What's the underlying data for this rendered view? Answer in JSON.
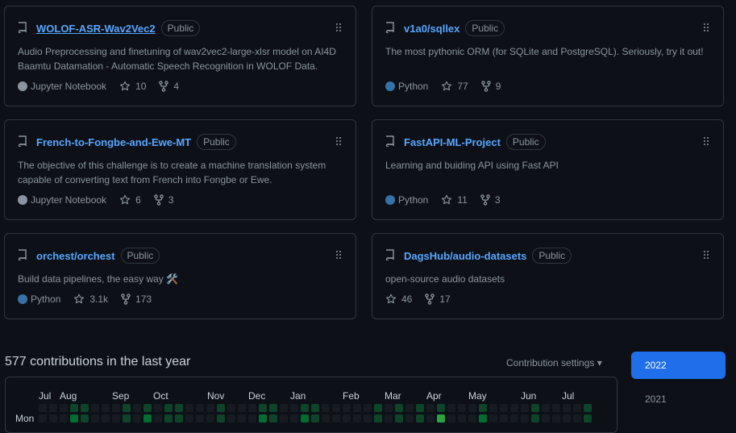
{
  "repos": [
    {
      "name": "WOLOF-ASR-Wav2Vec2",
      "badge": "Public",
      "description": "Audio Preprocessing and finetuning of wav2vec2-large-xlsr model on AI4D Baamtu Datamation - Automatic Speech Recognition in WOLOF Data.",
      "language": "Jupyter Notebook",
      "language_color": "#8b949e",
      "stars": "10",
      "forks": "4"
    },
    {
      "name": "v1a0/sqllex",
      "badge": "Public",
      "description": "The most pythonic ORM (for SQLite and PostgreSQL). Seriously, try it out!",
      "language": "Python",
      "language_color": "#3572A5",
      "stars": "77",
      "forks": "9"
    },
    {
      "name": "French-to-Fongbe-and-Ewe-MT",
      "badge": "Public",
      "description": "The objective of this challenge is to create a machine translation system capable of converting text from French into Fongbe or Ewe.",
      "language": "Jupyter Notebook",
      "language_color": "#8b949e",
      "stars": "6",
      "forks": "3"
    },
    {
      "name": "FastAPI-ML-Project",
      "badge": "Public",
      "description": "Learning and buiding API using Fast API",
      "language": "Python",
      "language_color": "#3572A5",
      "stars": "11",
      "forks": "3"
    },
    {
      "name": "orchest/orchest",
      "badge": "Public",
      "description": "Build data pipelines, the easy way 🛠️",
      "language": "Python",
      "language_color": "#3572A5",
      "stars": "3.1k",
      "forks": "173"
    },
    {
      "name": "DagsHub/audio-datasets",
      "badge": "Public",
      "description": "open-source audio datasets",
      "language": "",
      "language_color": "",
      "stars": "46",
      "forks": "17"
    }
  ],
  "contributions": {
    "title": "577 contributions in the last year",
    "settings_label": "Contribution settings ▾",
    "months": [
      "Jul",
      "Aug",
      "Sep",
      "Oct",
      "Nov",
      "Dec",
      "Jan",
      "Feb",
      "Mar",
      "Apr",
      "May",
      "Jun",
      "Jul"
    ],
    "day_label": "Mon",
    "years": [
      "2022",
      "2021"
    ],
    "active_year": "2022",
    "level_colors": [
      "#161b22",
      "#0e4429",
      "#006d32",
      "#26a641",
      "#39d353"
    ]
  }
}
